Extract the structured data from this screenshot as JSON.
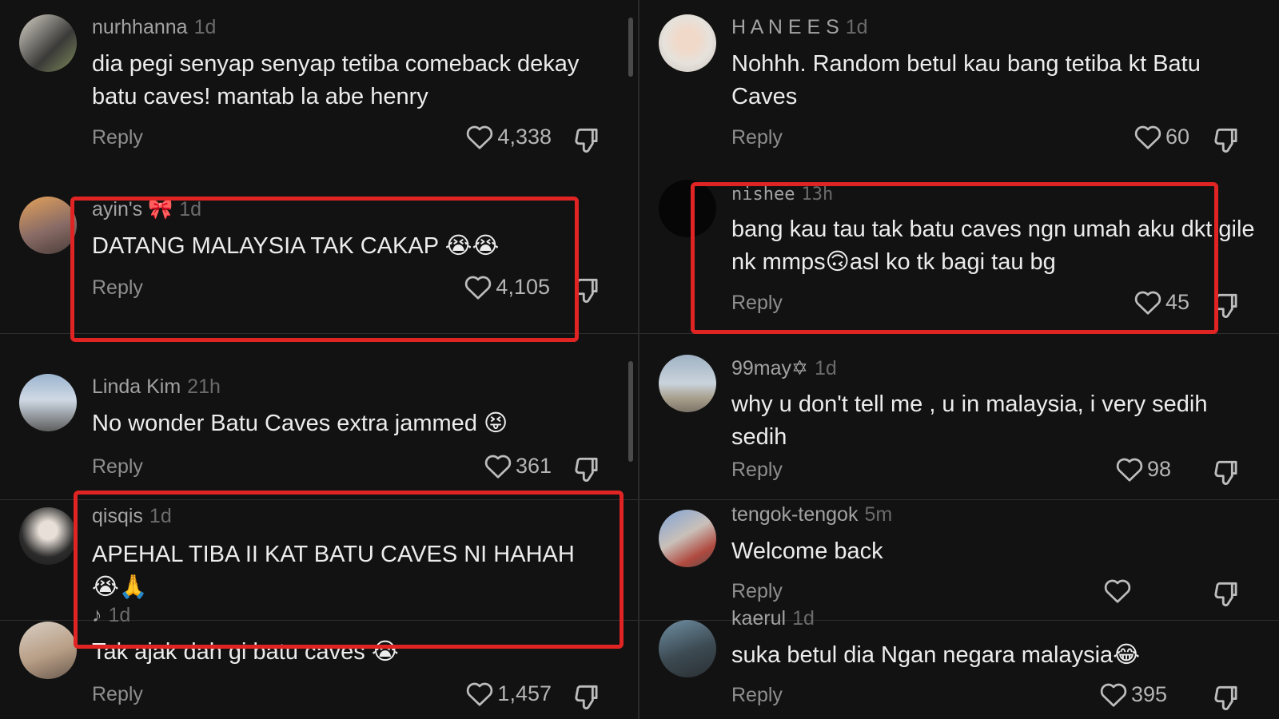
{
  "reply_label": "Reply",
  "colors": {
    "background": "#121212",
    "text_primary": "#ececec",
    "text_username": "#a2a2a2",
    "text_muted": "#8e8e8e",
    "highlight": "#e02424"
  },
  "left_comments": [
    {
      "username": "nurhhanna",
      "time": "1d",
      "text": "dia pegi senyap senyap tetiba comeback dekay batu caves! mantab la abe henry",
      "likes": "4,338"
    },
    {
      "username": "ayin's 🎀",
      "time": "1d",
      "text": "DATANG MALAYSIA TAK CAKAP 😭😭",
      "likes": "4,105"
    },
    {
      "username": "Linda Kim",
      "time": "21h",
      "text": "No wonder Batu Caves extra jammed 😝",
      "likes": "361"
    },
    {
      "username": "qisqis",
      "time": "1d",
      "text": "APEHAL TIBA II KAT BATU CAVES NI HAHAH 😭🙏",
      "likes": ""
    },
    {
      "username": "♪",
      "time": "1d",
      "text": "Tak ajak dah gi batu caves 😭",
      "likes": "1,457"
    }
  ],
  "right_comments": [
    {
      "username": "H A N E E S",
      "time": "1d",
      "text": "Nohhh. Random betul kau bang tetiba kt Batu Caves",
      "likes": "60"
    },
    {
      "username": "nishee",
      "time": "13h",
      "text": "bang kau tau tak batu caves ngn umah aku dkt gile nk mmps🙃asl ko tk bagi tau bg",
      "likes": "45"
    },
    {
      "username": "99may✡",
      "time": "1d",
      "text": "why u don't tell me , u in malaysia, i very sedih sedih",
      "likes": "98"
    },
    {
      "username": "tengok-tengok",
      "time": "5m",
      "text": "Welcome back",
      "likes": ""
    },
    {
      "username": "kaerul",
      "time": "1d",
      "text": "suka betul dia Ngan negara malaysia😂",
      "likes": "395"
    }
  ]
}
